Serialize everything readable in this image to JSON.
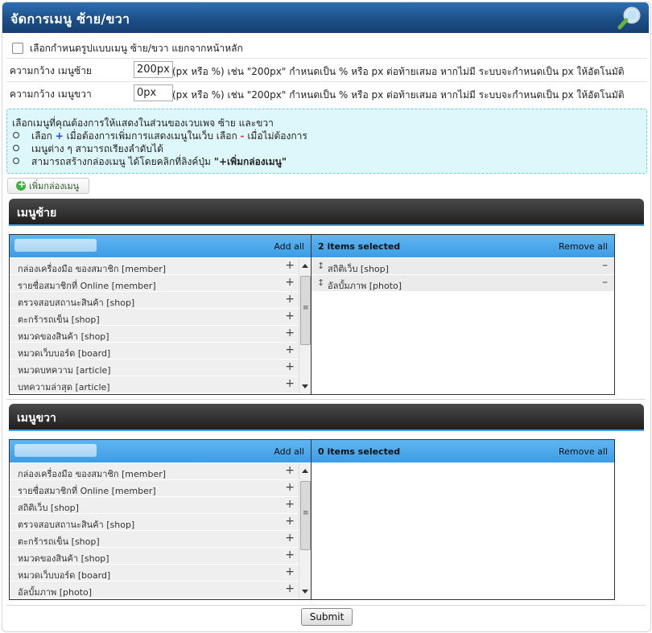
{
  "title": "จัดการเมนู ซ้าย/ขวา",
  "icons": {
    "header": "magnifier-icon",
    "add": "plus-circle-icon"
  },
  "checkbox_label": "เลือกกำหนดรูปแบบเมนู ซ้าย/ขวา แยกจากหน้าหลัก",
  "width_left": {
    "label": "ความกว้าง เมนูซ้าย",
    "value": "200px",
    "hint": "(px หรือ %) เช่น \"200px\" กำหนดเป็น % หรือ px ต่อท้ายเสมอ หากไม่มี ระบบจะกำหนดเป็น px ให้อัตโนมัติ"
  },
  "width_right": {
    "label": "ความกว้าง เมนูขวา",
    "value": "0px",
    "hint": "(px หรือ %) เช่น \"200px\" กำหนดเป็น % หรือ px ต่อท้ายเสมอ หากไม่มี ระบบจะกำหนดเป็น px ให้อัตโนมัติ"
  },
  "info": {
    "line0": "เลือกเมนูที่คุณต้องการให้แสดงในส่วนของเวบเพจ ซ้าย และขวา",
    "b1_a": "เลือก ",
    "b1_plus": "+",
    "b1_b": " เมื่อต้องการเพิ่มการแสดงเมนูในเว็บ เลือก ",
    "b1_minus": "-",
    "b1_c": " เมื่อไม่ต้องการ",
    "b2": "เมนูต่าง ๆ สามารถเรียงลำดับได้",
    "b3_a": "สามารถสร้างกล่องเมนู ได้โดยคลิกที่ลิงค์ปุ่ม ",
    "b3_b": "\"+เพิ่มกล่องเมนู\""
  },
  "add_box_label": "เพิ่มกล่องเมนู",
  "left_menu": {
    "title": "เมนูซ้าย",
    "add_all": "Add all",
    "count": "2 items selected",
    "remove_all": "Remove all",
    "available": [
      "กล่องเครื่องมือ ของสมาชิก [member]",
      "รายชื่อสมาชิกที่ Online [member]",
      "ตรวจสอบสถานะสินค้า [shop]",
      "ตะกร้ารถเข็น [shop]",
      "หมวดของสินค้า [shop]",
      "หมวดเว็บบอร์ด [board]",
      "หมวดบทความ [article]",
      "บทความล่าสุด [article]"
    ],
    "selected": [
      "สถิติเว็บ [shop]",
      "อัลบั้มภาพ [photo]"
    ]
  },
  "right_menu": {
    "title": "เมนูขวา",
    "add_all": "Add all",
    "count": "0 items selected",
    "remove_all": "Remove all",
    "available": [
      "กล่องเครื่องมือ ของสมาชิก [member]",
      "รายชื่อสมาชิกที่ Online [member]",
      "สถิติเว็บ [shop]",
      "ตรวจสอบสถานะสินค้า [shop]",
      "ตะกร้ารถเข็น [shop]",
      "หมวดของสินค้า [shop]",
      "หมวดเว็บบอร์ด [board]",
      "อัลบั้มภาพ [photo]"
    ],
    "selected": []
  },
  "submit_label": "Submit"
}
